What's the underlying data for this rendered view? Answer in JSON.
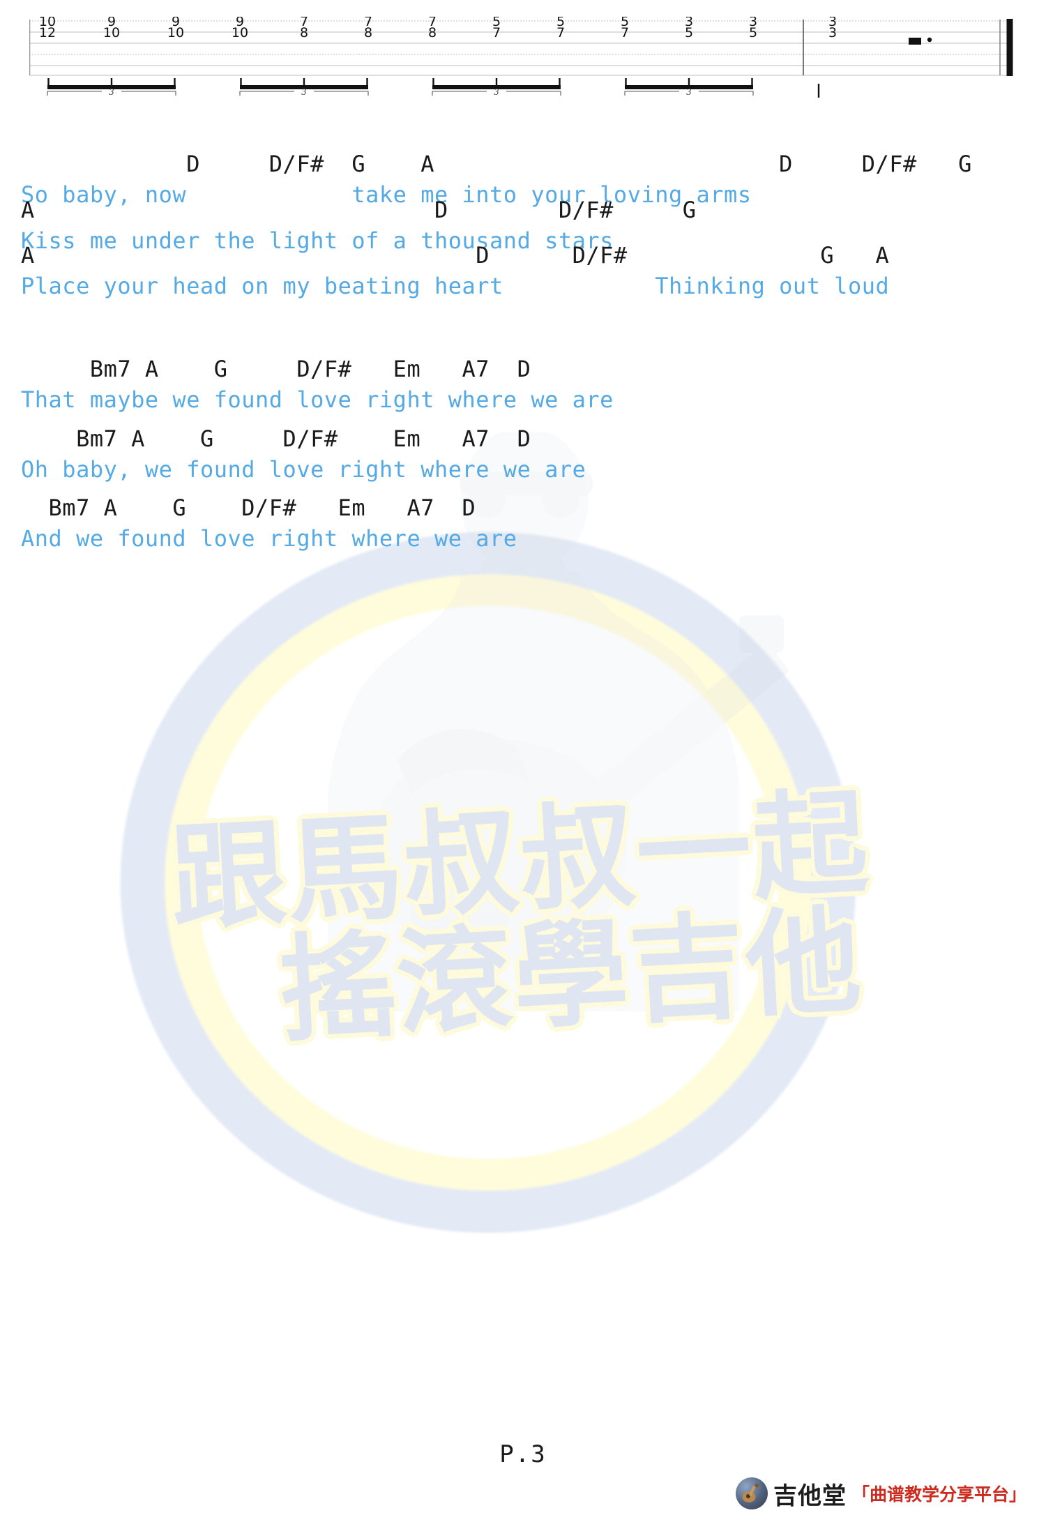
{
  "page": {
    "page_label": "P.3",
    "lyric_color": "#55aae4",
    "chord_color": "#1a1a1a"
  },
  "tab": {
    "strings": 6,
    "notes": [
      {
        "top": "10",
        "bottom": "12"
      },
      {
        "top": "9",
        "bottom": "10"
      },
      {
        "top": "9",
        "bottom": "10"
      },
      {
        "top": "9",
        "bottom": "10"
      },
      {
        "top": "7",
        "bottom": "8"
      },
      {
        "top": "7",
        "bottom": "8"
      },
      {
        "top": "7",
        "bottom": "8"
      },
      {
        "top": "5",
        "bottom": "7"
      },
      {
        "top": "5",
        "bottom": "7"
      },
      {
        "top": "5",
        "bottom": "7"
      },
      {
        "top": "3",
        "bottom": "5"
      },
      {
        "top": "3",
        "bottom": "5"
      },
      {
        "top": "3",
        "bottom": "3"
      }
    ],
    "tuplets": [
      "3",
      "3",
      "3",
      "3"
    ],
    "rest_symbol": "half-rest-dotted",
    "barline": "single",
    "end_barline": "final-double"
  },
  "sheet": {
    "blocks": [
      {
        "chords": "            D     D/F#  G    A                         D     D/F#   G",
        "lyrics": "So baby, now            take me into your loving arms"
      },
      {
        "chords": "A                             D        D/F#     G",
        "lyrics": "Kiss me under the light of a thousand stars"
      },
      {
        "chords": "A                                D      D/F#              G   A",
        "lyrics": "Place your head on my beating heart           Thinking out loud"
      },
      {
        "chords": "     Bm7 A    G     D/F#   Em   A7  D",
        "lyrics": "That maybe we found love right where we are"
      },
      {
        "chords": "    Bm7 A    G     D/F#    Em   A7  D",
        "lyrics": "Oh baby, we found love right where we are"
      },
      {
        "chords": "  Bm7 A    G    D/F#   Em   A7  D",
        "lyrics": "And we found love right where we are"
      }
    ]
  },
  "watermark": {
    "line1": "跟馬叔叔一起",
    "line2": "搖滾學吉他"
  },
  "footer": {
    "brand": "吉他堂",
    "tagline": "「曲谱教学分享平台」",
    "icon": "guitar-badge-icon"
  }
}
